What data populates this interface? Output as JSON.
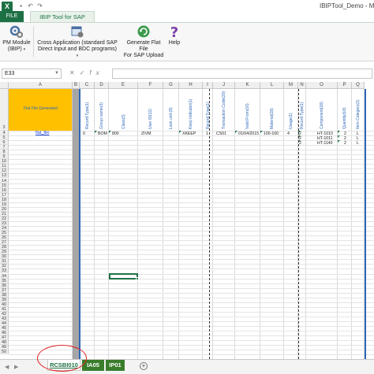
{
  "window": {
    "title": "IBIPTool_Demo - Micro",
    "app_logo": "X"
  },
  "tabs": {
    "file": "FILE",
    "ibip": "IBIP Tool for SAP"
  },
  "ribbon": {
    "pm_module": {
      "line1": "PM Module",
      "line2": "(IBIP)",
      "icon": "gears-icon"
    },
    "cross_app": {
      "line1": "Cross Application (standard SAP",
      "line2": "Direct Input and BDC programs)",
      "icon": "app-icon"
    },
    "generate": {
      "line1": "Generate Flat File",
      "line2": "For SAP Upload",
      "icon": "refresh-icon"
    },
    "help": {
      "line1": "Help",
      "icon": "question-icon"
    }
  },
  "formula_bar": {
    "name_box": "E33",
    "cancel": "✕",
    "enter": "✓",
    "fx": "fx",
    "value": ""
  },
  "columns": [
    "A",
    "B",
    "C",
    "D",
    "E",
    "F",
    "G",
    "H",
    "I",
    "J",
    "K",
    "L",
    "M",
    "N",
    "O",
    "P",
    "Q"
  ],
  "yellow_header": "Flat File Generated",
  "field_headers": [
    "Record Type(1)",
    "Group name(3)",
    "Class(3)",
    "User ID(12)",
    "Lock unit (8)",
    "Keep Indicator(1)",
    "Record Type(1)",
    "Transaction Code(20)",
    "Valid From(10)",
    "Material(18)",
    "Usage(1)",
    "Record Type(1)",
    "Component(18)",
    "Quantity(18)",
    "Item Category(1)"
  ],
  "row4": {
    "link": "flat_file",
    "cells": [
      "0",
      "BOM",
      "800",
      "ZIVM",
      "",
      "XKEEP",
      "1",
      "CS01",
      "01/04/2015",
      "100-100",
      "4"
    ]
  },
  "items": [
    {
      "rec": "2",
      "component": "HT-1010",
      "qty": "2",
      "cat": "L"
    },
    {
      "rec": "2",
      "component": "HT-1011",
      "qty": "2",
      "cat": "L"
    },
    {
      "rec": "2",
      "component": "HT-1140",
      "qty": "2",
      "cat": "L"
    }
  ],
  "row_numbers": [
    "3",
    "4",
    "5",
    "6",
    "7",
    "8",
    "9",
    "10",
    "11",
    "12",
    "13",
    "14",
    "15",
    "16",
    "17",
    "18",
    "19",
    "20",
    "21",
    "22",
    "23",
    "24",
    "25",
    "26",
    "27",
    "28",
    "29",
    "30",
    "31",
    "32",
    "33",
    "34",
    "35",
    "36",
    "37",
    "38",
    "39",
    "40",
    "41",
    "42",
    "43",
    "44",
    "45",
    "46",
    "47",
    "48",
    "49",
    "50"
  ],
  "sheets": {
    "active": "RCSBI010",
    "tab2": "IA05",
    "tab3": "IP01",
    "add": "+"
  },
  "colors": {
    "excel_green": "#1d7044",
    "yellow": "#ffc000",
    "blue": "#2e67b8",
    "red_circle": "#e02020"
  }
}
